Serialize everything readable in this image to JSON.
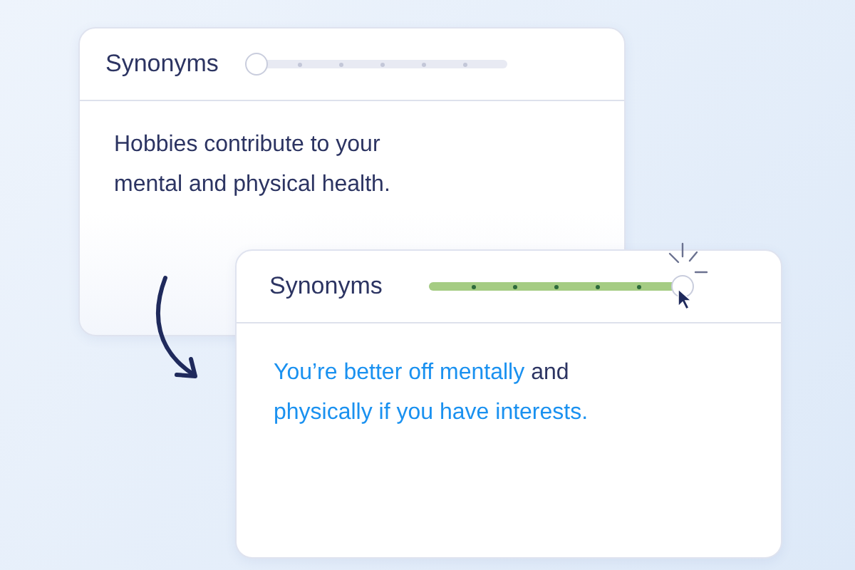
{
  "cards": [
    {
      "title": "Synonyms",
      "slider": {
        "level": 0,
        "active": false
      },
      "text": [
        {
          "text": "Hobbies contribute to your mental and physical health.",
          "changed": false
        }
      ]
    },
    {
      "title": "Synonyms",
      "slider": {
        "level": 1,
        "active": true
      },
      "text": [
        {
          "text": "You’re better off mentally",
          "changed": true
        },
        {
          "text": "and",
          "changed": false
        },
        {
          "text": "physically if you have interests.",
          "changed": true
        }
      ]
    }
  ]
}
